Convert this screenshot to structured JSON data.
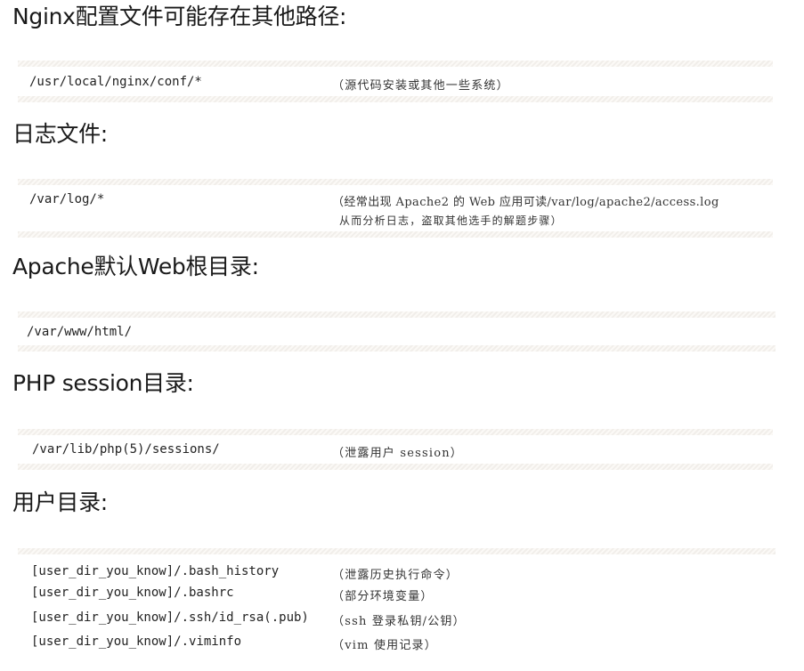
{
  "sections": [
    {
      "heading": "Nginx配置文件可能存在其他路径:",
      "rows": [
        {
          "path": "/usr/local/nginx/conf/*",
          "note": "（源代码安装或其他一些系统）"
        }
      ]
    },
    {
      "heading": "日志文件:",
      "rows": [
        {
          "path": "/var/log/*",
          "note": "（经常出现 Apache2 的 Web 应用可读/var/log/apache2/access.log",
          "note2": "从而分析日志，盗取其他选手的解题步骤）"
        }
      ]
    },
    {
      "heading": "Apache默认Web根目录:",
      "rows": [
        {
          "path": "/var/www/html/",
          "note": ""
        }
      ]
    },
    {
      "heading": "PHP session目录:",
      "rows": [
        {
          "path": "/var/lib/php(5)/sessions/",
          "note": "（泄露用户 session）"
        }
      ]
    },
    {
      "heading": "用户目录:",
      "rows": [
        {
          "path": "[user_dir_you_know]/.bash_history",
          "note": "（泄露历史执行命令）"
        },
        {
          "path": "[user_dir_you_know]/.bashrc",
          "note": "（部分环境变量）"
        },
        {
          "path": "[user_dir_you_know]/.ssh/id_rsa(.pub)",
          "note": "（ssh 登录私钥/公钥）"
        },
        {
          "path": "[user_dir_you_know]/.viminfo",
          "note": "（vim 使用记录）"
        }
      ]
    }
  ]
}
